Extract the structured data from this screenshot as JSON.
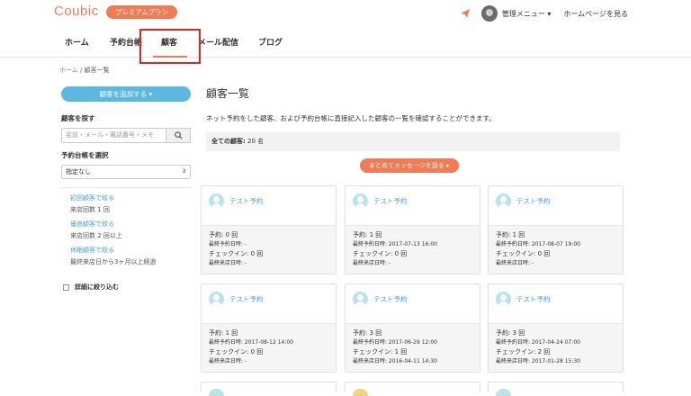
{
  "header": {
    "logo": "Coubic",
    "premium_badge": "プレミアムプラン",
    "admin_menu": "管理メニュー ▾",
    "homepage_link": "ホームページを見る"
  },
  "nav": {
    "items": [
      "ホーム",
      "予約台帳",
      "顧客",
      "メール配信",
      "ブログ"
    ],
    "active": "顧客"
  },
  "breadcrumb": {
    "home": "ホーム",
    "separator": "/",
    "current": "顧客一覧"
  },
  "sidebar": {
    "add_button": "顧客を追加する ▾",
    "search_label": "顧客を探す",
    "search_placeholder": "名前・メール・電話番号・メモ",
    "ledger_label": "予約台帳を選択",
    "ledger_selected": "指定なし",
    "filters": [
      {
        "link": "初回顧客で絞る",
        "sub": "来店回数 1 回"
      },
      {
        "link": "優良顧客で絞る",
        "sub": "来店回数 2 回以上"
      },
      {
        "link": "休眠顧客で絞る",
        "sub": "最終来店日から3ヶ月以上経過"
      }
    ],
    "detail_filter": "詳細に絞り込む"
  },
  "main": {
    "title": "顧客一覧",
    "description": "ネット予約をした顧客、および予約台帳に直接記入した顧客の一覧を確認することができます。",
    "total_label": "全ての顧客:",
    "total_value": "20 名",
    "message_button": "まとめてメッセージを送る ▸"
  },
  "cards": [
    {
      "name": "テスト予約",
      "reservations": "予約: 0 回",
      "last_reservation": "最終予約日時: -",
      "checkin": "チェックイン: 0 回",
      "last_visit": "最終来店日時: -"
    },
    {
      "name": "テスト予約",
      "reservations": "予約: 1 回",
      "last_reservation": "最終予約日時: 2017-07-13 16:00",
      "checkin": "チェックイン: 0 回",
      "last_visit": "最終来店日時: -"
    },
    {
      "name": "テスト予約",
      "reservations": "予約: 1 回",
      "last_reservation": "最終予約日時: 2017-08-07 19:00",
      "checkin": "チェックイン: 0 回",
      "last_visit": "最終来店日時: -"
    },
    {
      "name": "テスト予約",
      "reservations": "予約: 1 回",
      "last_reservation": "最終予約日時: 2017-08-12 14:00",
      "checkin": "チェックイン: 0 回",
      "last_visit": "最終来店日時: -"
    },
    {
      "name": "テスト予約",
      "reservations": "予約: 3 回",
      "last_reservation": "最終予約日時: 2017-06-29 12:00",
      "checkin": "チェックイン: 1 回",
      "last_visit": "最終来店日時: 2016-04-11 14:30"
    },
    {
      "name": "テスト予約",
      "reservations": "予約: 3 回",
      "last_reservation": "最終予約日時: 2017-04-24 07:00",
      "checkin": "チェックイン: 2 回",
      "last_visit": "最終来店日時: 2017-01-28 15:30"
    }
  ],
  "colors": {
    "brand": "#f07b54",
    "link": "#4a9fd4",
    "add_button": "#5bb8e0",
    "highlight_box": "#e0261d"
  }
}
